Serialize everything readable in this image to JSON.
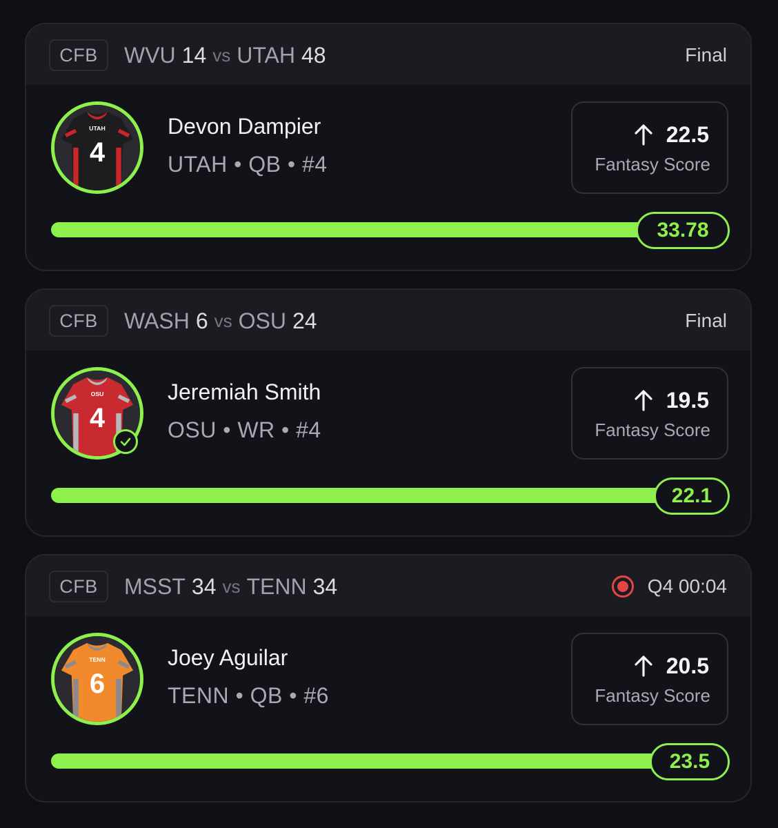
{
  "colors": {
    "accent": "#8ef04d",
    "live": "#e54545",
    "card_bg": "#121219",
    "header_bg": "#1b1b22"
  },
  "cards": [
    {
      "league": "CFB",
      "away_team": "WVU",
      "away_score": "14",
      "vs": "vs",
      "home_team": "UTAH",
      "home_score": "48",
      "status": "Final",
      "live": false,
      "player": {
        "name": "Devon Dampier",
        "meta": "UTAH • QB • #4",
        "jersey_team": "UTAH",
        "jersey_number": "4",
        "jersey_color": "#1d1d1f",
        "jersey_accent": "#c8262b",
        "verified": false
      },
      "projection": {
        "icon": "arrow-up-icon",
        "value": "22.5",
        "label": "Fantasy Score"
      },
      "actual": "33.78",
      "progress": 1.0
    },
    {
      "league": "CFB",
      "away_team": "WASH",
      "away_score": "6",
      "vs": "vs",
      "home_team": "OSU",
      "home_score": "24",
      "status": "Final",
      "live": false,
      "player": {
        "name": "Jeremiah Smith",
        "meta": "OSU • WR • #4",
        "jersey_team": "OSU",
        "jersey_number": "4",
        "jersey_color": "#c92a2f",
        "jersey_accent": "#b8b8bc",
        "verified": true
      },
      "projection": {
        "icon": "arrow-up-icon",
        "value": "19.5",
        "label": "Fantasy Score"
      },
      "actual": "22.1",
      "progress": 1.0
    },
    {
      "league": "CFB",
      "away_team": "MSST",
      "away_score": "34",
      "vs": "vs",
      "home_team": "TENN",
      "home_score": "34",
      "status": "Q4 00:04",
      "live": true,
      "player": {
        "name": "Joey Aguilar",
        "meta": "TENN • QB • #6",
        "jersey_team": "TENN",
        "jersey_number": "6",
        "jersey_color": "#f08a2c",
        "jersey_accent": "#8a8a90",
        "verified": false
      },
      "projection": {
        "icon": "arrow-up-icon",
        "value": "20.5",
        "label": "Fantasy Score"
      },
      "actual": "23.5",
      "progress": 1.0
    }
  ]
}
